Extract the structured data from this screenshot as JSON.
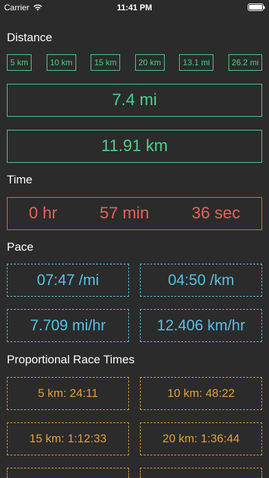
{
  "status_bar": {
    "carrier": "Carrier",
    "time": "11:41 PM",
    "icons": {
      "wifi": "wifi-icon",
      "battery": "battery-icon"
    }
  },
  "distance": {
    "title": "Distance",
    "presets": [
      "5 km",
      "10 km",
      "15 km",
      "20 km",
      "13.1 mi",
      "26.2 mi"
    ],
    "miles": "7.4 mi",
    "kilometers": "11.91 km"
  },
  "time": {
    "title": "Time",
    "hours": "0 hr",
    "minutes": "57 min",
    "seconds": "36 sec"
  },
  "pace": {
    "title": "Pace",
    "per_mile": "07:47 /mi",
    "per_km": "04:50 /km",
    "mph": "7.709 mi/hr",
    "kph": "12.406 km/hr"
  },
  "race_times": {
    "title": "Proportional Race Times",
    "items": [
      "5 km: 24:11",
      "10 km: 48:22",
      "15 km: 1:12:33",
      "20 km: 1:36:44"
    ]
  },
  "colors": {
    "background": "#2b2b2b",
    "distance_accent": "#4fd08a",
    "time_accent": "#e8615a",
    "pace_accent": "#55c3e6",
    "race_accent": "#e3a03b"
  }
}
